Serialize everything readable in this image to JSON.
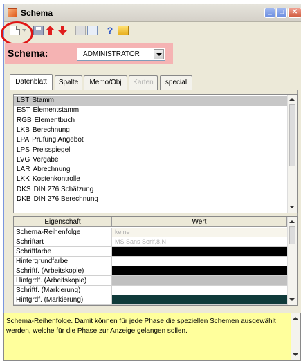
{
  "window": {
    "title": "Schema"
  },
  "toolbar": {
    "icons": [
      "new-document-icon",
      "dropdown-arrow-icon",
      "save-icon",
      "move-up-icon",
      "move-down-icon",
      "print-icon",
      "print-preview-icon",
      "help-icon",
      "open-folder-icon"
    ],
    "highlight_color": "#e01414"
  },
  "schema": {
    "label": "Schema:",
    "selected": "ADMINISTRATOR",
    "bar_color": "#f5b3b3"
  },
  "tabs": [
    {
      "label": "Datenblatt",
      "state": "active"
    },
    {
      "label": "Spalte",
      "state": "normal"
    },
    {
      "label": "Memo/Obj",
      "state": "normal"
    },
    {
      "label": "Karten",
      "state": "disabled"
    },
    {
      "label": "special",
      "state": "normal"
    }
  ],
  "schema_list": {
    "selected_index": 0,
    "items": [
      {
        "code": "LST",
        "name": "Stamm"
      },
      {
        "code": "EST",
        "name": "Elementstamm"
      },
      {
        "code": "RGB",
        "name": "Elementbuch"
      },
      {
        "code": "LKB",
        "name": "Berechnung"
      },
      {
        "code": "LPA",
        "name": "Prüfung Angebot"
      },
      {
        "code": "LPS",
        "name": "Preisspiegel"
      },
      {
        "code": "LVG",
        "name": "Vergabe"
      },
      {
        "code": "LAR",
        "name": "Abrechnung"
      },
      {
        "code": "LKK",
        "name": "Kostenkontrolle"
      },
      {
        "code": "DKS",
        "name": "DIN 276 Schätzung"
      },
      {
        "code": "DKB",
        "name": "DIN 276 Berechnung"
      }
    ]
  },
  "properties": {
    "headers": [
      "Eigenschaft",
      "Wert"
    ],
    "rows": [
      {
        "name": "Schema-Reihenfolge",
        "value": "keine",
        "swatch": "#f7f5ec"
      },
      {
        "name": "Schriftart",
        "value": "MS Sans Serif,8,N",
        "swatch": "#ffffff"
      },
      {
        "name": "Schriftfarbe",
        "value": "",
        "swatch": "#000000"
      },
      {
        "name": "Hintergrundfarbe",
        "value": "",
        "swatch": "#ffffff"
      },
      {
        "name": "Schriftf. (Arbeitskopie)",
        "value": "",
        "swatch": "#000000"
      },
      {
        "name": "Hintgrdf. (Arbeitskopie)",
        "value": "",
        "swatch": "#c0c0c0"
      },
      {
        "name": "Schriftf. (Markierung)",
        "value": "",
        "swatch": "#ffffff"
      },
      {
        "name": "Hintgrdf. (Markierung)",
        "value": "",
        "swatch": "#0f3a3a"
      }
    ]
  },
  "description": {
    "text": "Schema-Reihenfolge. Damit können für jede Phase die speziellen Schemen ausgewählt werden, welche für die Phase zur Anzeige gelangen sollen.",
    "background": "#ffff9c"
  }
}
